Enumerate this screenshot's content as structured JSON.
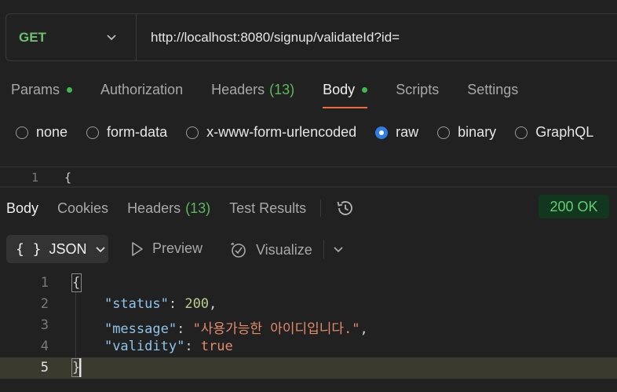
{
  "request": {
    "method": "GET",
    "url": "http://localhost:8080/signup/validateId?id=",
    "tabs": [
      {
        "label": "Params",
        "dot": true
      },
      {
        "label": "Authorization"
      },
      {
        "label": "Headers",
        "count": "(13)"
      },
      {
        "label": "Body",
        "dot": true,
        "active": true
      },
      {
        "label": "Scripts"
      },
      {
        "label": "Settings"
      }
    ],
    "body_types": [
      "none",
      "form-data",
      "x-www-form-urlencoded",
      "raw",
      "binary",
      "GraphQL"
    ],
    "selected_body_type": "raw",
    "editor_line_number": "1",
    "editor_first_char": "{"
  },
  "response": {
    "tabs": [
      {
        "label": "Body",
        "active": true
      },
      {
        "label": "Cookies"
      },
      {
        "label": "Headers",
        "count": "(13)"
      },
      {
        "label": "Test Results"
      }
    ],
    "status": "200 OK",
    "format": "JSON",
    "preview_label": "Preview",
    "visualize_label": "Visualize",
    "lines": [
      {
        "n": "1",
        "text": "{"
      },
      {
        "n": "2",
        "key": "\"status\"",
        "value": "200",
        "vtype": "num",
        "comma": true
      },
      {
        "n": "3",
        "key": "\"message\"",
        "value": "\"사용가능한 아이디입니다.\"",
        "vtype": "str",
        "comma": true
      },
      {
        "n": "4",
        "key": "\"validity\"",
        "value": "true",
        "vtype": "bool",
        "comma": false
      },
      {
        "n": "5",
        "text": "}"
      }
    ]
  },
  "colors": {
    "method_get": "#6cc070",
    "accent_tab": "#ef6b3a",
    "status_ok_bg": "#13361e",
    "status_ok_text": "#5fcf72",
    "radio_selected": "#2e7de6"
  },
  "icons": [
    "chevron-down-icon",
    "history-icon",
    "braces-icon",
    "play-icon",
    "visualize-icon"
  ]
}
